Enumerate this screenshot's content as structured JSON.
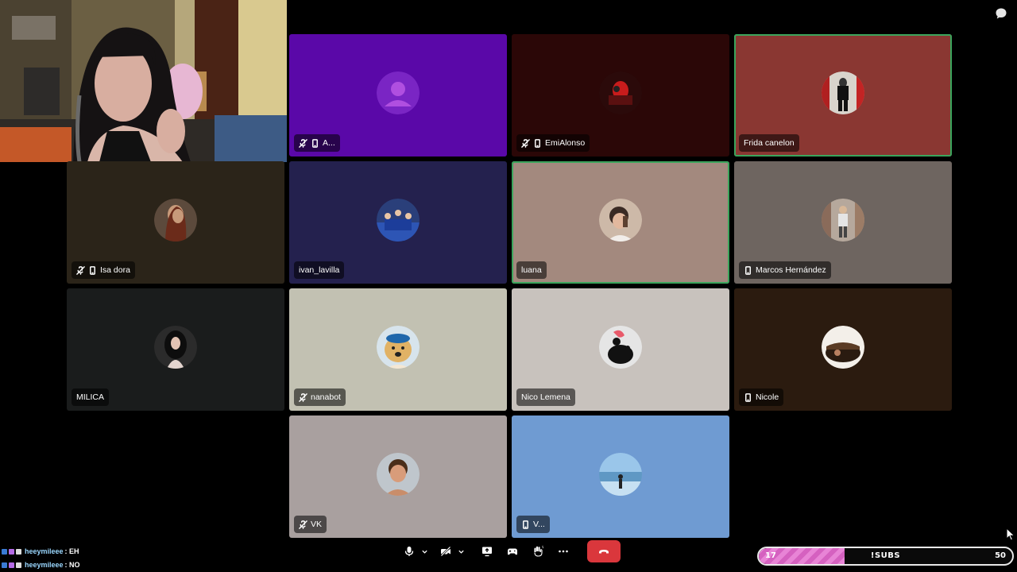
{
  "participants": [
    {
      "name": "A...",
      "muted": true,
      "mobile": true,
      "bg": "#5a08a8"
    },
    {
      "name": "EmiAlonso",
      "muted": true,
      "mobile": true,
      "bg": "#2b0707"
    },
    {
      "name": "Frida canelon",
      "muted": false,
      "mobile": false,
      "bg": "#8a3732",
      "speaking": true
    },
    {
      "name": "Isa dora",
      "muted": true,
      "mobile": true,
      "bg": "#2b2419"
    },
    {
      "name": "ivan_lavilla",
      "muted": false,
      "mobile": false,
      "bg": "#24214e"
    },
    {
      "name": "luana",
      "muted": false,
      "mobile": false,
      "bg": "#a3897e",
      "speaking": true
    },
    {
      "name": "Marcos Hernández",
      "muted": false,
      "mobile": true,
      "bg": "#6e6560"
    },
    {
      "name": "MILICA",
      "muted": false,
      "mobile": false,
      "bg": "#1a1c1c"
    },
    {
      "name": "nanabot",
      "muted": true,
      "mobile": false,
      "bg": "#c2c1b2"
    },
    {
      "name": "Nico Lemena",
      "muted": false,
      "mobile": false,
      "bg": "#c8c2bd"
    },
    {
      "name": "Nicole",
      "muted": false,
      "mobile": true,
      "bg": "#2b1b0f"
    },
    {
      "name": "VK",
      "muted": true,
      "mobile": false,
      "bg": "#a9a09f"
    },
    {
      "name": "V...",
      "muted": false,
      "mobile": true,
      "bg": "#6f9bd2"
    }
  ],
  "chat": [
    {
      "user": "heeymileee",
      "message": ": EH"
    },
    {
      "user": "heeymileee",
      "message": ": NO"
    }
  ],
  "sub_goal": {
    "current": "17",
    "label": "!SUBS",
    "target": "50",
    "progress": 0.34
  },
  "icons": {
    "chat": "chat-bubble-icon",
    "mic": "microphone-icon",
    "camera": "camera-off-icon",
    "screen": "screen-share-icon",
    "activity": "activity-icon",
    "soundboard": "soundboard-icon",
    "more": "more-icon",
    "hangup": "hangup-icon"
  },
  "colors": {
    "hangup": "#da373c",
    "speaking_border": "#3ba55c",
    "sub_fill": "#e884d6"
  }
}
